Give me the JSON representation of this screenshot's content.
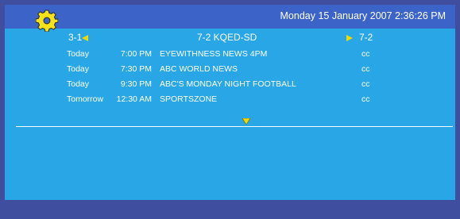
{
  "header": {
    "datetime": "Monday 15 January 2007 2:36:26 PM",
    "settings_icon": "gear-icon"
  },
  "channels": {
    "previous": "3-1",
    "current": "7-2 KQED-SD",
    "next": "7-2"
  },
  "listings": [
    {
      "day": "Today",
      "time": "7:00 PM",
      "title": "EYEWITHNESS NEWS 4PM",
      "cc": "cc"
    },
    {
      "day": "Today",
      "time": "7:30 PM",
      "title": "ABC WORLD NEWS",
      "cc": "cc"
    },
    {
      "day": "Today",
      "time": "9:30 PM",
      "title": "ABC'S MONDAY NIGHT FOOTBALL",
      "cc": "cc"
    },
    {
      "day": "Tomorrow",
      "time": "12:30 AM",
      "title": "SPORTSZONE",
      "cc": "cc"
    }
  ],
  "colors": {
    "panel_bg": "#29a6e6",
    "top_band": "#3b63c8",
    "frame": "#3f4e9e",
    "arrow": "#f2d800"
  }
}
